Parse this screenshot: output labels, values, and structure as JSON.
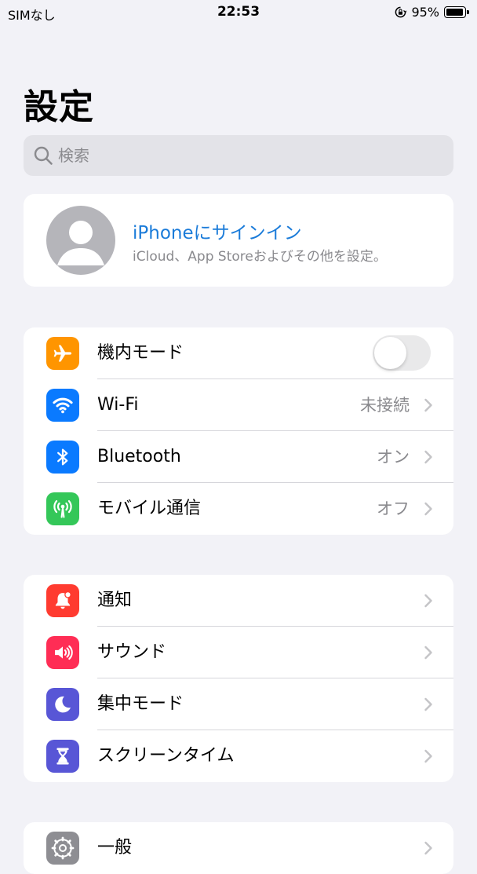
{
  "status_bar": {
    "carrier": "SIMなし",
    "time": "22:53",
    "battery_text": "95%",
    "battery_level": 0.95
  },
  "page": {
    "title": "設定"
  },
  "search": {
    "placeholder": "検索"
  },
  "account": {
    "title": "iPhoneにサインイン",
    "subtitle": "iCloud、App Storeおよびその他を設定。"
  },
  "groups": [
    {
      "rows": [
        {
          "label": "機内モード",
          "icon": "airplane-icon",
          "color": "#ff9500",
          "toggle_on": false
        },
        {
          "label": "Wi-Fi",
          "icon": "wifi-icon",
          "color": "#0a7aff",
          "value": "未接続"
        },
        {
          "label": "Bluetooth",
          "icon": "bluetooth-icon",
          "color": "#0a7aff",
          "value": "オン"
        },
        {
          "label": "モバイル通信",
          "icon": "antenna-icon",
          "color": "#34c759",
          "value": "オフ"
        }
      ]
    },
    {
      "rows": [
        {
          "label": "通知",
          "icon": "bell-badge-icon",
          "color": "#ff3b30"
        },
        {
          "label": "サウンド",
          "icon": "speaker-icon",
          "color": "#ff2d55"
        },
        {
          "label": "集中モード",
          "icon": "moon-icon",
          "color": "#5856d6"
        },
        {
          "label": "スクリーンタイム",
          "icon": "hourglass-icon",
          "color": "#5856d6"
        }
      ]
    },
    {
      "rows": [
        {
          "label": "一般",
          "icon": "gear-icon",
          "color": "#8e8e93"
        }
      ]
    }
  ]
}
